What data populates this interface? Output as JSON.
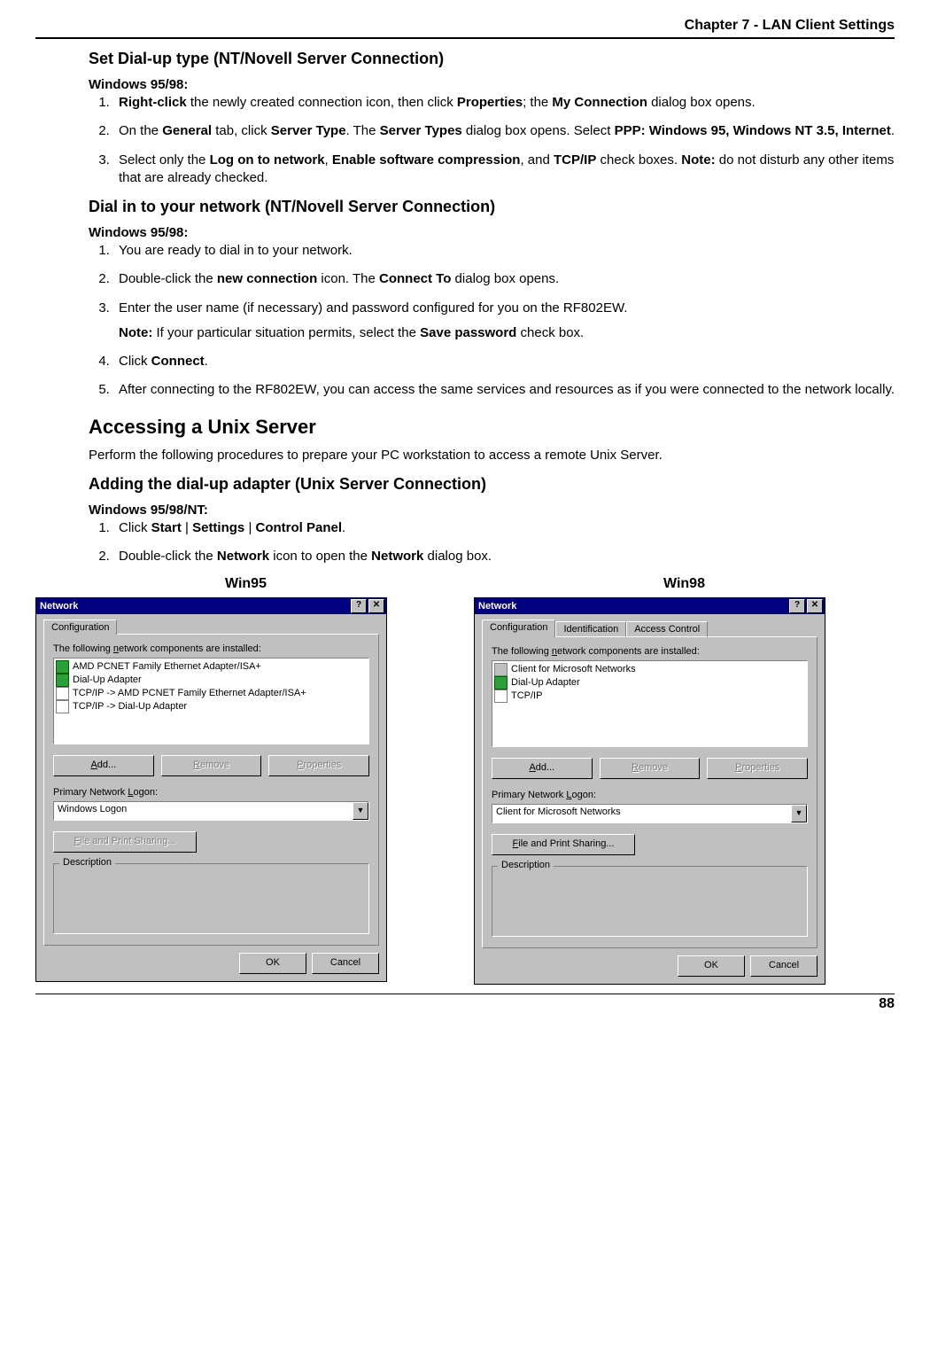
{
  "header": {
    "chapter": "Chapter 7 - LAN Client Settings",
    "page_number": "88"
  },
  "sections": {
    "s1": {
      "title": "Set Dial-up type (NT/Novell Server Connection)",
      "subhead": "Windows 95/98:",
      "li1_a": "Right-click",
      "li1_b": " the newly created connection icon, then click ",
      "li1_c": "Properties",
      "li1_d": "; the ",
      "li1_e": "My Connection",
      "li1_f": " dialog box opens.",
      "li2_a": "On the ",
      "li2_b": "General",
      "li2_c": " tab, click ",
      "li2_d": "Server Type",
      "li2_e": ". The ",
      "li2_f": "Server Types",
      "li2_g": " dialog box opens. Select ",
      "li2_h": "PPP: Windows 95, Windows NT 3.5, Internet",
      "li2_i": ".",
      "li3_a": "Select only the ",
      "li3_b": "Log on to network",
      "li3_c": ", ",
      "li3_d": "Enable software compression",
      "li3_e": ", and ",
      "li3_f": "TCP/IP",
      "li3_g": " check boxes. ",
      "li3_h": "Note:",
      "li3_i": " do not disturb any other items that are already checked."
    },
    "s2": {
      "title": "Dial in to your network (NT/Novell Server Connection)",
      "subhead": "Windows 95/98:",
      "li1": "You are ready to dial in to your network.",
      "li2_a": "Double-click the ",
      "li2_b": "new connection",
      "li2_c": " icon.  The ",
      "li2_d": "Connect To",
      "li2_e": " dialog box opens.",
      "li3": "Enter the user name (if necessary) and password configured for you on the RF802EW.",
      "note_a": "Note:",
      "note_b": " If your particular situation permits, select the ",
      "note_c": "Save password",
      "note_d": " check box.",
      "li4_a": "Click ",
      "li4_b": "Connect",
      "li4_c": ".",
      "li5": "After connecting to the RF802EW, you can access the same services and resources as if you were connected to the network locally."
    },
    "s3": {
      "title": "Accessing a Unix Server",
      "intro": "Perform the following procedures to prepare your PC workstation to access a remote Unix Server."
    },
    "s4": {
      "title": "Adding the dial-up adapter (Unix Server Connection)",
      "subhead": "Windows 95/98/NT:",
      "li1_a": "Click ",
      "li1_b": "Start",
      "li1_c": " | ",
      "li1_d": "Settings",
      "li1_e": " | ",
      "li1_f": "Control Panel",
      "li1_g": ".",
      "li2_a": "Double-click the ",
      "li2_b": "Network",
      "li2_c": " icon to open the ",
      "li2_d": "Network",
      "li2_e": " dialog box."
    }
  },
  "dialogs": {
    "labels": {
      "win95": "Win95",
      "win98": "Win98"
    },
    "common": {
      "title": "Network",
      "help_btn": "?",
      "close_btn": "✕",
      "tab_config": "Configuration",
      "tab_ident": "Identification",
      "tab_access": "Access Control",
      "list_label_a": "The following ",
      "list_label_u": "n",
      "list_label_b": "etwork components are installed:",
      "btn_add_u": "A",
      "btn_add": "dd...",
      "btn_remove_u": "R",
      "btn_remove": "emove",
      "btn_props_u": "P",
      "btn_props": "roperties",
      "logon_label_a": "Primary Network ",
      "logon_label_u": "L",
      "logon_label_b": "ogon:",
      "fps_u": "F",
      "fps": "ile and Print Sharing...",
      "desc": "Description",
      "ok": "OK",
      "cancel": "Cancel"
    },
    "win95": {
      "components": [
        "AMD PCNET Family Ethernet Adapter/ISA+",
        "Dial-Up Adapter",
        "TCP/IP -> AMD PCNET Family Ethernet Adapter/ISA+",
        "TCP/IP -> Dial-Up Adapter"
      ],
      "logon": "Windows Logon",
      "fps_disabled": true
    },
    "win98": {
      "components": [
        "Client for Microsoft Networks",
        "Dial-Up Adapter",
        "TCP/IP"
      ],
      "logon": "Client for Microsoft Networks",
      "fps_disabled": false
    }
  }
}
